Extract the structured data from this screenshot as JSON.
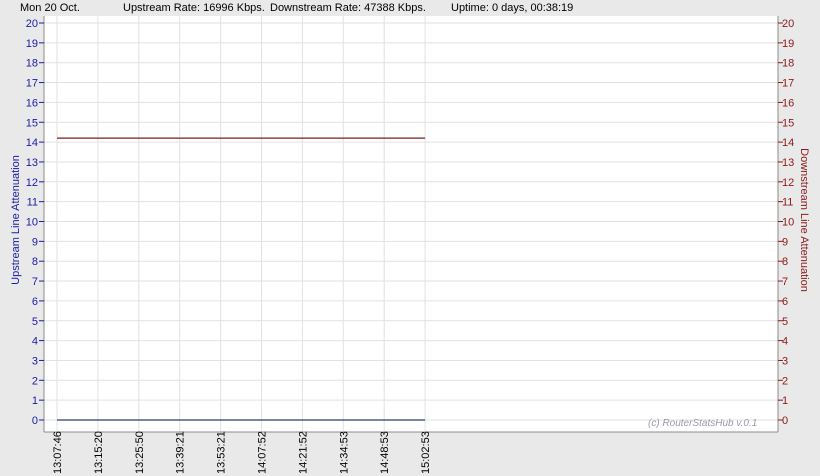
{
  "header": {
    "date": "Mon 20 Oct.",
    "upstream_rate": "Upstream Rate: 16996 Kbps.",
    "downstream_rate": "Downstream Rate: 47388 Kbps.",
    "uptime": "Uptime: 0 days, 00:38:19"
  },
  "watermark": "(c) RouterStatsHub v.0.1",
  "colors": {
    "upstream": "#1a1aa8",
    "downstream": "#8a1a1a",
    "grid": "#e2e2e2",
    "upstream_line": "#2a3e6a",
    "downstream_line": "#7a1e1e"
  },
  "chart_data": {
    "type": "line",
    "x": [
      "13:07:46",
      "13:15:20",
      "13:25:50",
      "13:39:21",
      "13:53:21",
      "14:07:52",
      "14:21:52",
      "14:34:53",
      "14:48:53",
      "15:02:53"
    ],
    "series": [
      {
        "axis": "left",
        "values": [
          0,
          0,
          0,
          0,
          0,
          0,
          0,
          0,
          0,
          0
        ]
      },
      {
        "axis": "right",
        "values": [
          14.2,
          14.2,
          14.2,
          14.2,
          14.2,
          14.2,
          14.2,
          14.2,
          14.2,
          14.2
        ]
      }
    ],
    "ylabel_left": "Upstream Line Attenuation",
    "ylabel_right": "Downstream Line Attenuation",
    "ylim": [
      0,
      20
    ],
    "yticks": [
      0,
      1,
      2,
      3,
      4,
      5,
      6,
      7,
      8,
      9,
      10,
      11,
      12,
      13,
      14,
      15,
      16,
      17,
      18,
      19,
      20
    ],
    "grid": true
  }
}
